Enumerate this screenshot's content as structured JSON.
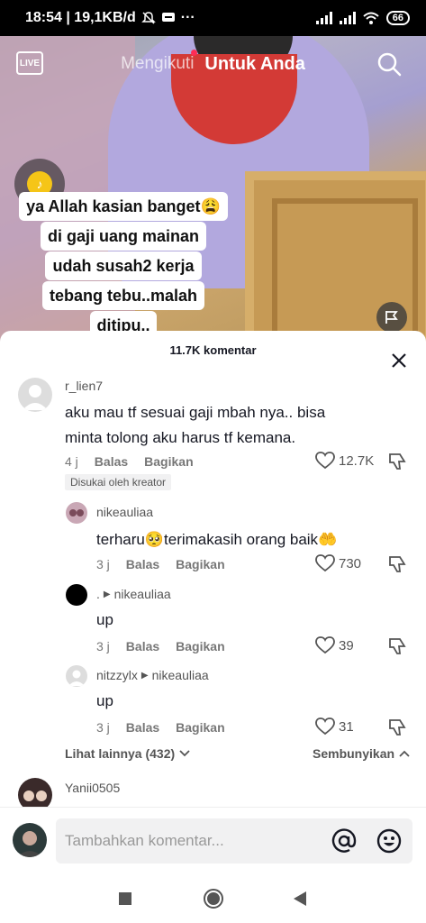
{
  "status_bar": {
    "time_speed": "18:54 | 19,1KB/d",
    "battery": "66",
    "more": "···"
  },
  "top_nav": {
    "live_label": "LIVE",
    "following": "Mengikuti",
    "for_you": "Untuk Anda"
  },
  "caption": {
    "lines": [
      "ya Allah kasian banget😩",
      "di gaji uang mainan",
      "udah susah2 kerja",
      "tebang tebu..malah",
      "ditipu.."
    ]
  },
  "comments_sheet": {
    "count_label": "11.7K komentar",
    "comments": [
      {
        "username": "r_lien7",
        "text_line1": "aku mau tf sesuai gaji mbah nya.. bisa",
        "text_line2": "minta tolong aku harus tf kemana.",
        "time": "4 j",
        "reply": "Balas",
        "share": "Bagikan",
        "likes": "12.7K",
        "badge": "Disukai oleh kreator"
      },
      {
        "username": "nikeauliaa",
        "text": "terharu🥺terimakasih orang baik🤲",
        "time": "3 j",
        "reply": "Balas",
        "share": "Bagikan",
        "likes": "730"
      },
      {
        "username": ".",
        "reply_to": "nikeauliaa",
        "text": "up",
        "time": "3 j",
        "reply": "Balas",
        "share": "Bagikan",
        "likes": "39"
      },
      {
        "username": "nitzzylx",
        "reply_to": "nikeauliaa",
        "text": "up",
        "time": "3 j",
        "reply": "Balas",
        "share": "Bagikan",
        "likes": "31"
      },
      {
        "username": "Yanii0505"
      }
    ],
    "view_more": "Lihat lainnya (432)",
    "hide": "Sembunyikan"
  },
  "input": {
    "placeholder": "Tambahkan komentar..."
  },
  "colors": {
    "accent_red": "#fe2c55",
    "text_primary": "#161823",
    "text_secondary": "#777777"
  }
}
